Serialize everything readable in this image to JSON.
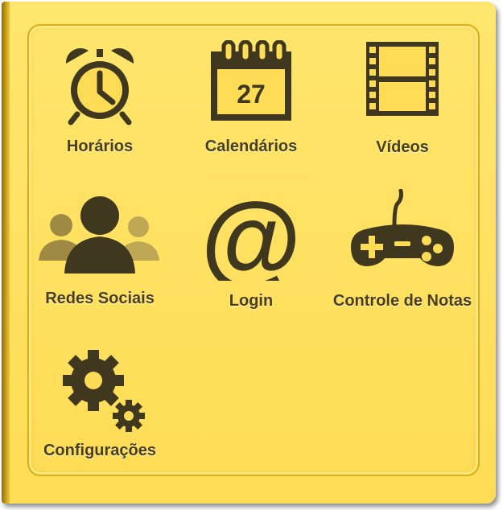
{
  "menu": {
    "items": [
      {
        "label": "Horários",
        "icon": "alarm-clock-icon"
      },
      {
        "label": "Calendários",
        "icon": "calendar-icon",
        "day": "27"
      },
      {
        "label": "Vídeos",
        "icon": "film-strip-icon"
      },
      {
        "label": "Redes Sociais",
        "icon": "users-icon"
      },
      {
        "label": "Login",
        "icon": "at-sign-icon"
      },
      {
        "label": "Controle de Notas",
        "icon": "gamepad-icon"
      },
      {
        "label": "Configurações",
        "icon": "gears-icon"
      }
    ]
  },
  "colors": {
    "background": "#ffdc55",
    "icon": "#3f381e",
    "label": "#4a3f1c",
    "border": "#d8ae1c"
  }
}
